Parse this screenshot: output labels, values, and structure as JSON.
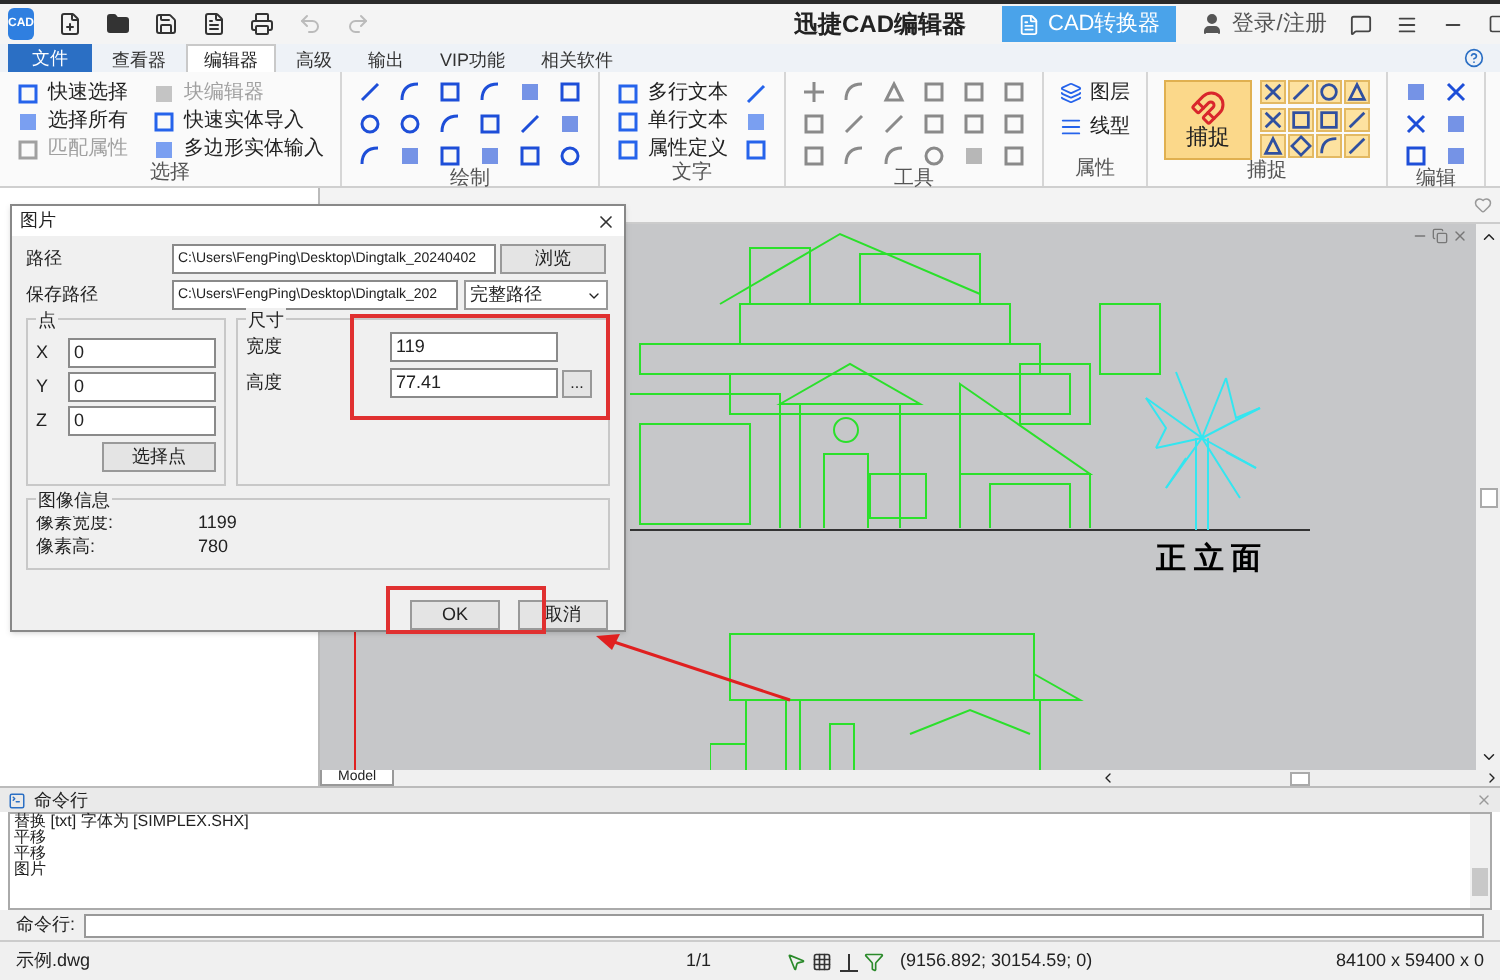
{
  "window": {
    "logo_text": "CAD",
    "title": "迅捷CAD编辑器",
    "converter_button": "CAD转换器",
    "login": "登录/注册"
  },
  "menu_tabs": [
    {
      "label": "文件",
      "kind": "file",
      "selected": false
    },
    {
      "label": "查看器",
      "kind": "tab",
      "selected": false
    },
    {
      "label": "编辑器",
      "kind": "tab",
      "selected": true
    },
    {
      "label": "高级",
      "kind": "tab",
      "selected": false
    },
    {
      "label": "输出",
      "kind": "tab",
      "selected": false
    },
    {
      "label": "VIP功能",
      "kind": "tab",
      "selected": false
    },
    {
      "label": "相关软件",
      "kind": "tab",
      "selected": false
    }
  ],
  "ribbon": [
    {
      "label": "选择",
      "kind": "commands",
      "commands": [
        {
          "label": "快速选择",
          "disabled": false
        },
        {
          "label": "选择所有",
          "disabled": false
        },
        {
          "label": "匹配属性",
          "disabled": true
        },
        {
          "label": "块编辑器",
          "disabled": true
        },
        {
          "label": "快速实体导入",
          "disabled": false
        },
        {
          "label": "多边形实体输入",
          "disabled": false
        }
      ]
    },
    {
      "label": "绘制",
      "kind": "draw"
    },
    {
      "label": "文字",
      "kind": "text",
      "commands": [
        {
          "label": "多行文本",
          "disabled": false
        },
        {
          "label": "单行文本",
          "disabled": false
        },
        {
          "label": "属性定义",
          "disabled": false
        }
      ]
    },
    {
      "label": "工具",
      "kind": "tools"
    },
    {
      "label": "属性",
      "kind": "props",
      "commands": [
        {
          "label": "图层",
          "disabled": false
        },
        {
          "label": "线型",
          "disabled": false
        }
      ]
    },
    {
      "label": "捕捉",
      "kind": "snap",
      "button": "捕捉"
    },
    {
      "label": "编辑",
      "kind": "edit"
    }
  ],
  "drawing": {
    "title": "正 立 面",
    "layout_tab": "Model"
  },
  "dialog": {
    "title": "图片",
    "path_label": "路径",
    "path_value": "C:\\Users\\FengPing\\Desktop\\Dingtalk_20240402",
    "browse_button": "浏览",
    "save_label": "保存路径",
    "save_value": "C:\\Users\\FengPing\\Desktop\\Dingtalk_202",
    "save_mode": "完整路径",
    "point_group": "点",
    "point_fields": [
      {
        "label": "X",
        "value": "0"
      },
      {
        "label": "Y",
        "value": "0"
      },
      {
        "label": "Z",
        "value": "0"
      }
    ],
    "pick_button": "选择点",
    "size_group": "尺寸",
    "size_fields": [
      {
        "label": "宽度",
        "value": "119"
      },
      {
        "label": "高度",
        "value": "77.41"
      }
    ],
    "more_button": "...",
    "info_group": "图像信息",
    "info_rows": [
      {
        "label": "像素宽度:",
        "value": "1199"
      },
      {
        "label": "像素高:",
        "value": "780"
      }
    ],
    "ok_button": "OK",
    "cancel_button": "取消"
  },
  "command_panel": {
    "title": "命令行",
    "lines": [
      "替换 [txt] 字体为 [SIMPLEX.SHX]",
      "平移",
      "平移",
      "图片"
    ],
    "prompt": "命令行:"
  },
  "status_bar": {
    "file": "示例.dwg",
    "page": "1/1",
    "coords": "(9156.892; 30154.59; 0)",
    "extent": "84100 x 59400 x 0"
  }
}
